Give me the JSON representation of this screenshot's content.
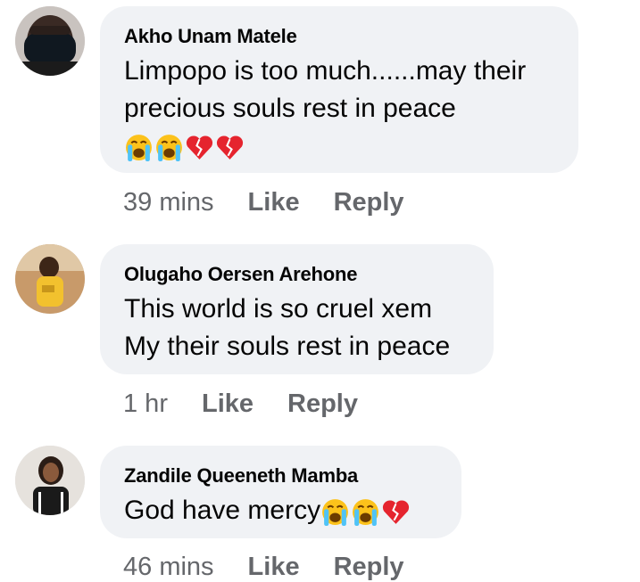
{
  "comments": [
    {
      "author": "Akho Unam Matele",
      "lines": [
        "Limpopo is too much......may their",
        "precious souls rest in peace"
      ],
      "emojis": [
        "loudly-crying-face",
        "loudly-crying-face",
        "broken-heart",
        "broken-heart"
      ],
      "time": "39 mins",
      "like_label": "Like",
      "reply_label": "Reply"
    },
    {
      "author": "Olugaho Oersen Arehone",
      "lines": [
        "This world is so cruel xem",
        "My their souls rest in peace"
      ],
      "time": "1 hr",
      "like_label": "Like",
      "reply_label": "Reply"
    },
    {
      "author": "Zandile Queeneth Mamba",
      "lines": [
        "God have mercy"
      ],
      "emojis": [
        "loudly-crying-face",
        "loudly-crying-face",
        "broken-heart"
      ],
      "time": "46 mins",
      "like_label": "Like",
      "reply_label": "Reply"
    }
  ],
  "colors": {
    "bubble": "#f0f2f5",
    "meta_text": "#65676b",
    "emoji_yellow": "#fcc21b",
    "tear_blue": "#4fc3f7",
    "heart_red": "#e5242e"
  }
}
